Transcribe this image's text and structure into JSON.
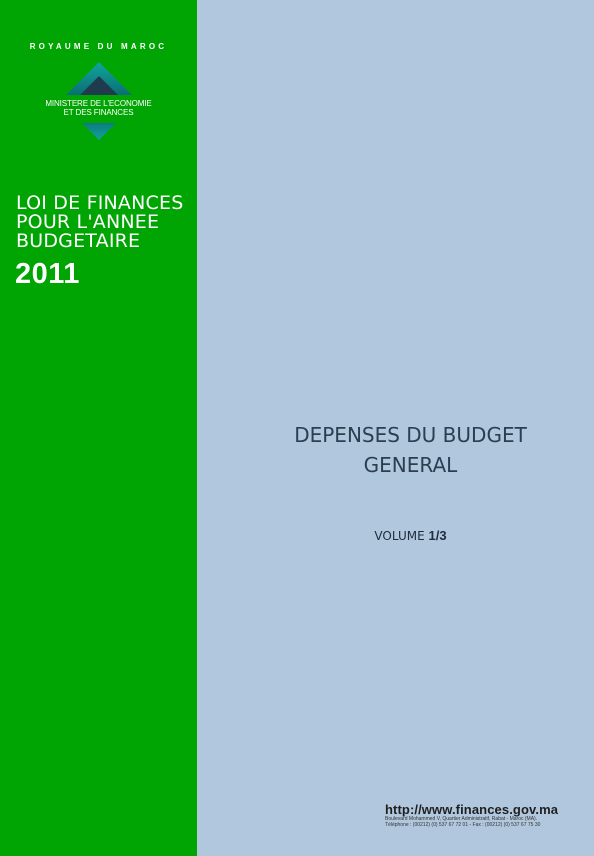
{
  "cover": {
    "kingdom": "ROYAUME DU MAROC",
    "ministry_line1": "MINISTERE DE L'ECONOMIE",
    "ministry_line2": "ET DES FINANCES",
    "loi_line1": "LOI DE FINANCES",
    "loi_line2": "POUR L'ANNEE",
    "loi_line3": "BUDGETAIRE",
    "year": "2011",
    "title_line1": "DEPENSES DU BUDGET",
    "title_line2": "GENERAL",
    "volume_label": "VOLUME",
    "volume_number": "1/3",
    "website": "http://www.finances.gov.ma",
    "address": "Boulevard Mohammed V, Quartier Administratif, Rabat - Maroc (MA).",
    "phone": "Téléphone : (00212) (0) 537 67 72 01 - Fax : (00212) (0) 537 67 75 30"
  },
  "colors": {
    "green_panel": "#01a503",
    "blue_panel": "#b1c7de",
    "logo_teal": "#0e8a88",
    "logo_dark": "#1f3b4d"
  },
  "icons": {
    "ministry_logo": "ministry-logo-icon"
  }
}
